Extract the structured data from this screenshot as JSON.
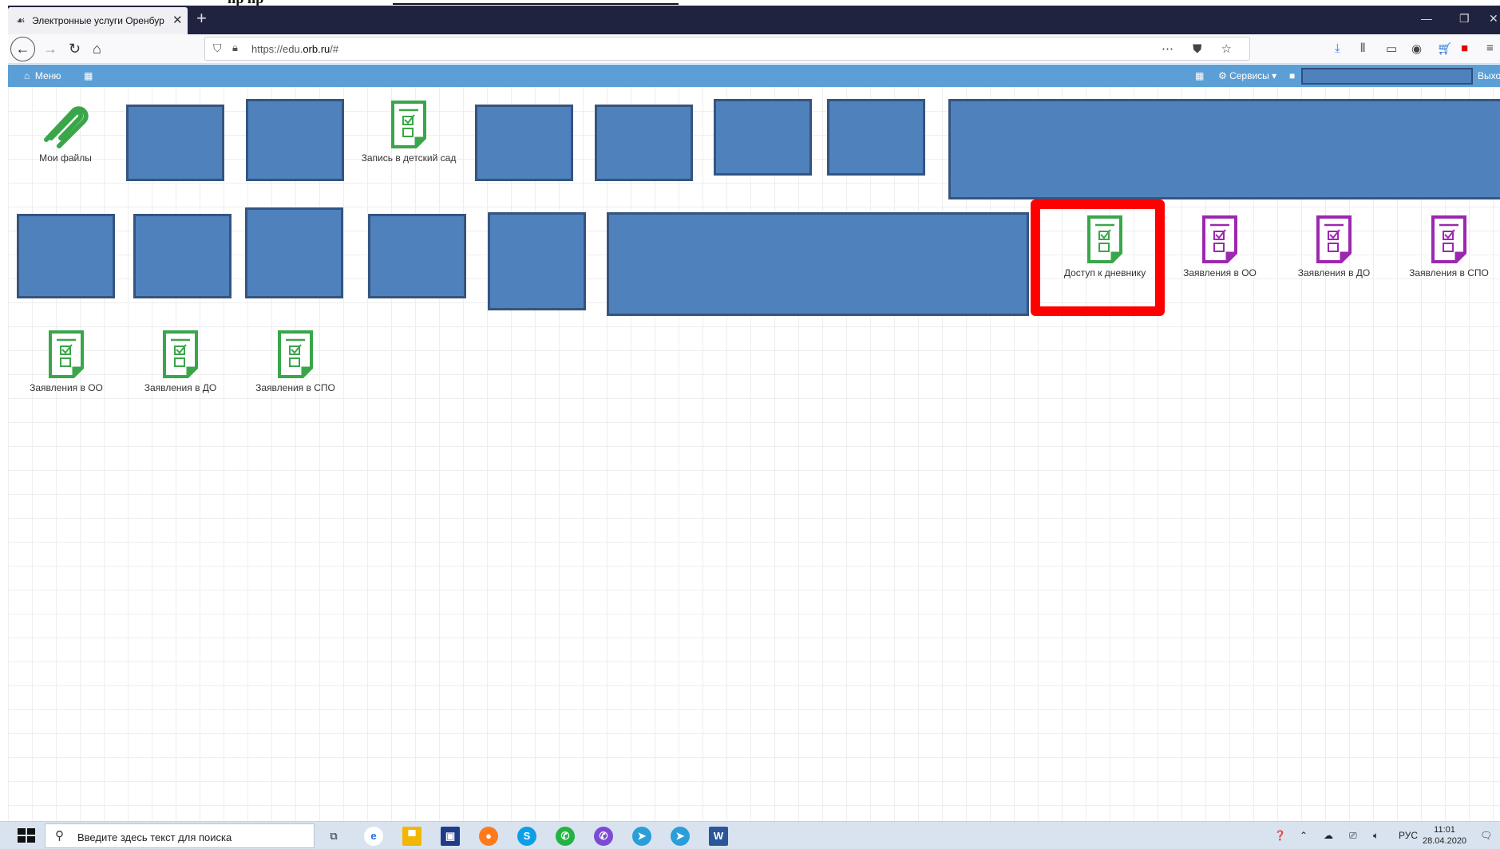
{
  "browser": {
    "tab_title": "Электронные услуги Оренбур",
    "url_prefix": "https://edu.",
    "url_domain": "orb.ru",
    "url_suffix": "/#"
  },
  "site_header": {
    "menu_label": "Меню",
    "services_label": "Сервисы",
    "logout_label": "Выхо"
  },
  "tiles": {
    "my_files": "Мои файлы",
    "kindergarten": "Запись в детский сад",
    "diary_access": "Доступ к дневнику",
    "apps_oo_purple": "Заявления в ОО",
    "apps_do_purple": "Заявления в ДО",
    "apps_spo_purple": "Заявления в СПО",
    "apps_oo_green": "Заявления в ОО",
    "apps_do_green": "Заявления в ДО",
    "apps_spo_green": "Заявления в СПО"
  },
  "taskbar": {
    "search_placeholder": "Введите здесь текст для поиска",
    "language": "РУС",
    "time": "11:01",
    "date": "28.04.2020"
  },
  "colors": {
    "header_blue": "#5c9fd6",
    "redaction_fill": "#4f81bd",
    "icon_green": "#3aa64a",
    "icon_purple": "#9c27b0",
    "highlight_red": "#ff0000"
  }
}
